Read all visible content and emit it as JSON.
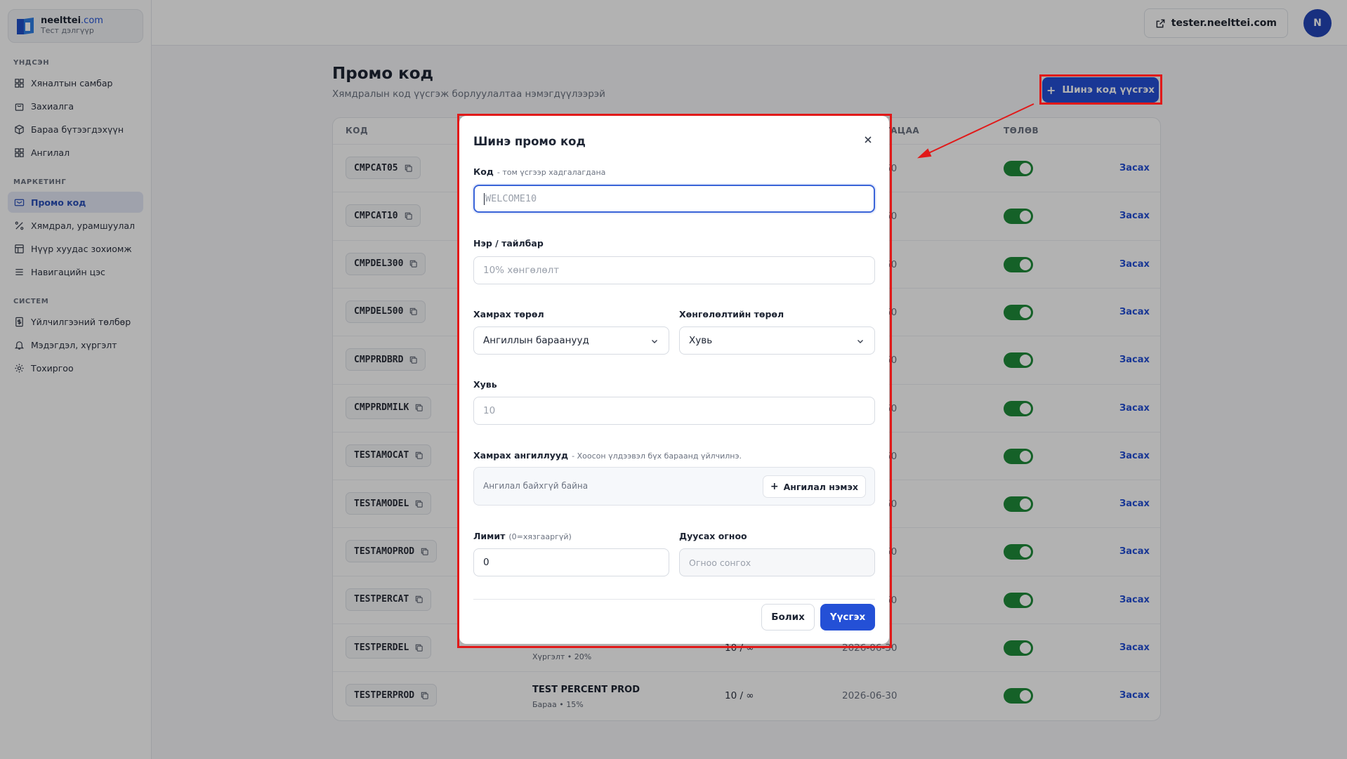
{
  "brand": {
    "name": "neelttei",
    "domain": ".com",
    "subtitle": "Тест дэлгүүр"
  },
  "sidebar": {
    "sections": [
      {
        "title": "ҮНДСЭН",
        "items": [
          {
            "label": "Хяналтын самбар",
            "icon": "dashboard-icon"
          },
          {
            "label": "Захиалга",
            "icon": "shopping-bag-icon"
          },
          {
            "label": "Бараа бүтээгдэхүүн",
            "icon": "box-icon"
          },
          {
            "label": "Ангилал",
            "icon": "grid-icon"
          }
        ]
      },
      {
        "title": "МАРКЕТИНГ",
        "items": [
          {
            "label": "Промо код",
            "icon": "ticket-icon",
            "active": true
          },
          {
            "label": "Хямдрал, урамшуулал",
            "icon": "percent-icon"
          },
          {
            "label": "Нүүр хуудас зохиомж",
            "icon": "layout-icon"
          },
          {
            "label": "Навигацийн цэс",
            "icon": "menu-icon"
          }
        ]
      },
      {
        "title": "СИСТЕМ",
        "items": [
          {
            "label": "Үйлчилгээний төлбөр",
            "icon": "invoice-icon"
          },
          {
            "label": "Мэдэгдэл, хүргэлт",
            "icon": "bell-icon"
          },
          {
            "label": "Тохиргоо",
            "icon": "gear-icon"
          }
        ]
      }
    ]
  },
  "topbar": {
    "site_label": "tester.neelttei.com",
    "avatar_initial": "N"
  },
  "page": {
    "title": "Промо код",
    "subtitle": "Хямдралын код үүсгэж борлуулалтаа нэмэгдүүлээрэй",
    "new_button": "Шинэ код үүсгэх"
  },
  "table": {
    "headers": {
      "code": "КОД",
      "expiry": "ГАЦАА",
      "status": "ТӨЛӨВ"
    },
    "edit_label": "Засах",
    "rows": [
      {
        "code": "CMPCAT05",
        "usage": "",
        "date": "50"
      },
      {
        "code": "CMPCAT10",
        "usage": "",
        "date": "50"
      },
      {
        "code": "CMPDEL300",
        "usage": "",
        "date": "50"
      },
      {
        "code": "CMPDEL500",
        "usage": "",
        "date": "50"
      },
      {
        "code": "CMPPRDBRD",
        "usage": "",
        "date": "50"
      },
      {
        "code": "CMPPRDMILK",
        "usage": "",
        "date": "50"
      },
      {
        "code": "TESTAMOCAT",
        "usage": "",
        "date": "50"
      },
      {
        "code": "TESTAMODEL",
        "usage": "",
        "date": "50"
      },
      {
        "code": "TESTAMOPROD",
        "usage": "",
        "date": "50"
      },
      {
        "code": "TESTPERCAT",
        "usage": "",
        "date": "50"
      },
      {
        "code": "TESTPERDEL",
        "name": "",
        "meta": "Хүргэлт • 20%",
        "usage": "10 / ∞",
        "date": "2026-06-30"
      },
      {
        "code": "TESTPERPROD",
        "name": "TEST PERCENT PROD",
        "meta": "Бараа • 15%",
        "usage": "10 / ∞",
        "date": "2026-06-30"
      }
    ]
  },
  "modal": {
    "title": "Шинэ промо код",
    "code_label": "Код",
    "code_hint": "- том үсгээр хадгалагдана",
    "code_placeholder": "WELCOME10",
    "name_label": "Нэр / тайлбар",
    "name_placeholder": "10% хөнгөлөлт",
    "scope_label": "Хамрах төрөл",
    "scope_value": "Ангиллын бараанууд",
    "discount_type_label": "Хөнгөлөлтийн төрөл",
    "discount_type_value": "Хувь",
    "percent_label": "Хувь",
    "percent_placeholder": "10",
    "categories_label": "Хамрах ангиллууд",
    "categories_hint": "- Хоосон үлдээвэл бүх бараанд үйлчилнэ.",
    "categories_empty": "Ангилал байхгүй байна",
    "categories_add": "Ангилал нэмэх",
    "limit_label": "Лимит",
    "limit_hint": "(0=хязгааргүй)",
    "limit_value": "0",
    "end_date_label": "Дуусах огноо",
    "end_date_placeholder": "Огноо сонгох",
    "cancel_label": "Болих",
    "create_label": "Үүсгэх"
  },
  "colors": {
    "accent": "#2450d6",
    "toggle_on": "#1f8b3a",
    "highlight": "#e11919"
  }
}
